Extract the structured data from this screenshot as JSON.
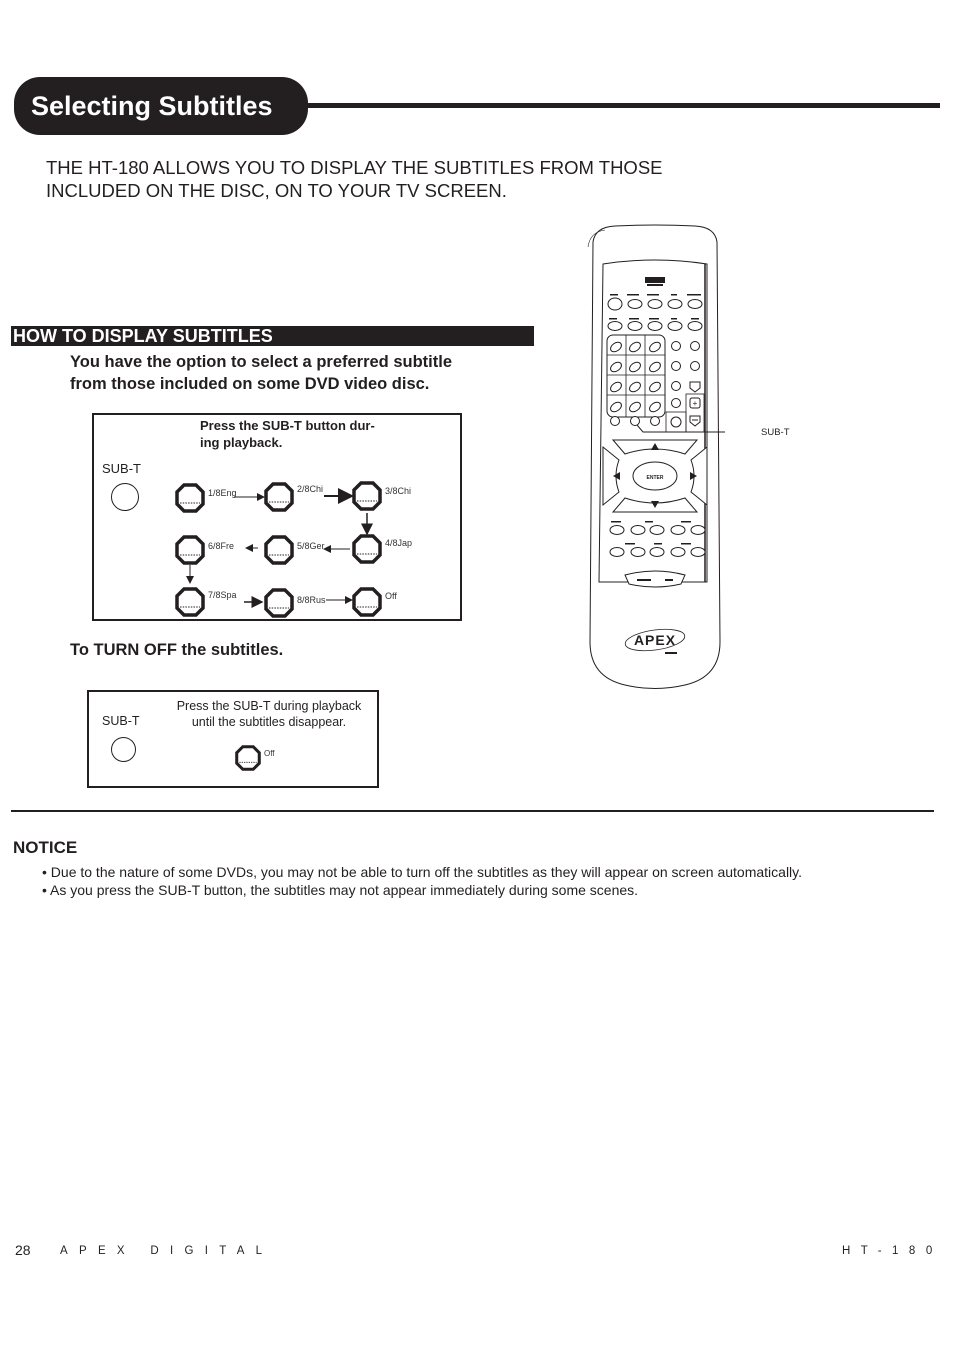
{
  "header": {
    "title": "Selecting Subtitles"
  },
  "intro": {
    "lines": [
      "THE HT-180 ALLOWS YOU TO DISPLAY THE SUBTITLES FROM THOSE",
      "INCLUDED ON THE DISC, ON TO YOUR TV SCREEN."
    ]
  },
  "how_to": {
    "heading": "HOW TO DISPLAY SUBTITLES",
    "description_lines": [
      "You have the option to select a preferred subtitle",
      "from those included on some DVD video disc."
    ],
    "diagram": {
      "caption_lines": [
        "Press the SUB-T button dur-",
        "ing playback."
      ],
      "button_label": "SUB-T",
      "steps": [
        "1/8Eng",
        "2/8Chi",
        "3/8Chi",
        "4/8Jap",
        "5/8Ger",
        "6/8Fre",
        "7/8Spa",
        "8/8Rus",
        "Off"
      ]
    }
  },
  "turn_off": {
    "heading": "To TURN OFF the subtitles.",
    "diagram": {
      "button_label": "SUB-T",
      "caption_lines": [
        "Press the SUB-T during playback",
        "until the subtitles disappear."
      ],
      "step": "Off"
    }
  },
  "remote": {
    "callout_label": "SUB-T",
    "brand": "APEX",
    "center_button": "ENTER"
  },
  "notice": {
    "heading": "NOTICE",
    "items": [
      "• Due to the nature of some DVDs, you may not be able to turn off the subtitles as they will appear on screen automatically.",
      "• As you press the SUB-T button, the subtitles may not appear immediately during some scenes."
    ]
  },
  "footer": {
    "page_number": "28",
    "brand": "APEX DIGITAL",
    "model": "HT-180"
  }
}
